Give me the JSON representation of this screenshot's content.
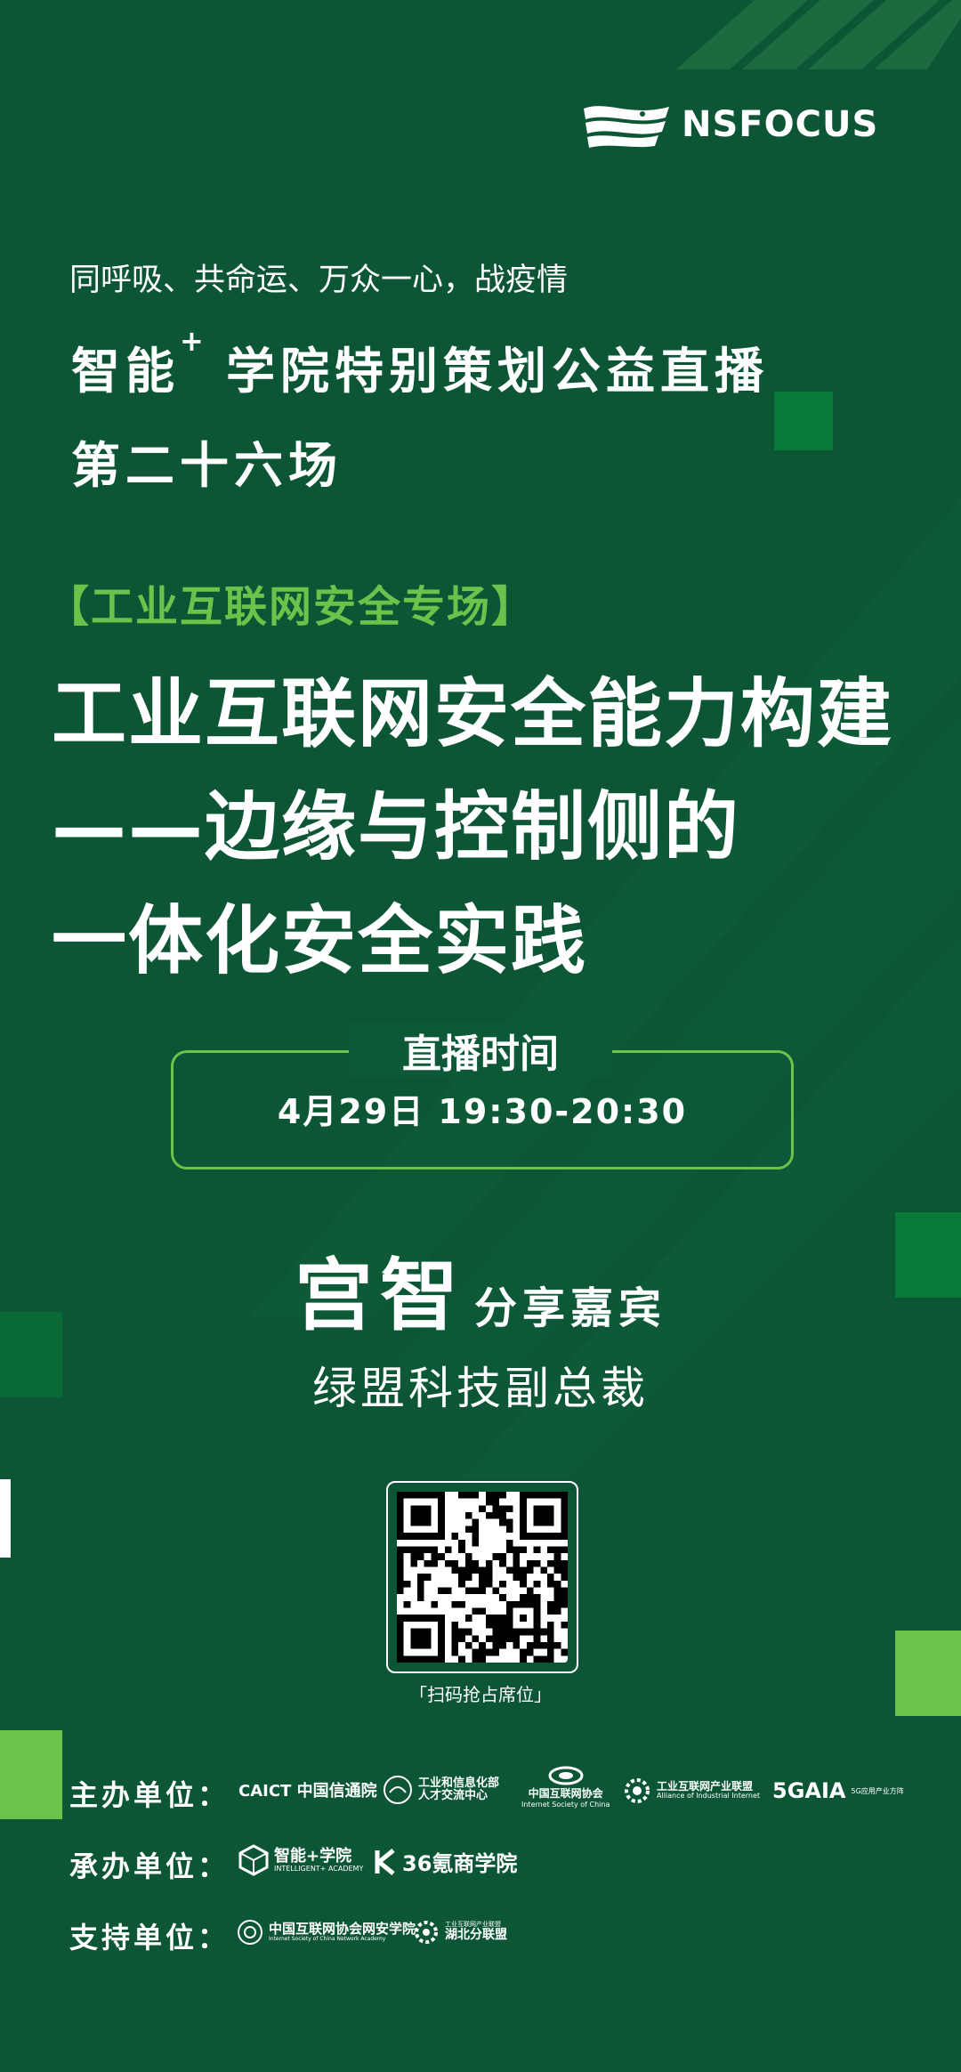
{
  "brand": {
    "logo_text": "NSFOCUS"
  },
  "header": {
    "slogan": "同呼吸、共命运、万众一心，战疫情",
    "headline_line1": "智能",
    "headline_sup": "+",
    "headline_line1_rest": "学院特别策划公益直播",
    "headline_line2": "第二十六场"
  },
  "topic": "【工业互联网安全专场】",
  "title": {
    "line1": "工业互联网安全能力构建",
    "line2": "——边缘与控制侧的",
    "line3": "一体化安全实践"
  },
  "schedule": {
    "label": "直播时间",
    "value": "4月29日 19:30-20:30"
  },
  "speaker": {
    "name": "宫智",
    "role": "分享嘉宾",
    "title": "绿盟科技副总裁"
  },
  "qr": {
    "caption": "「扫码抢占席位」"
  },
  "organizers": {
    "host_label": "主办单位：",
    "host": [
      {
        "main": "CAICT 中国信通院"
      },
      {
        "main": "工业和信息化部",
        "sub": "人才交流中心"
      },
      {
        "main": "中国互联网协会",
        "sub": "Internet Society of China"
      },
      {
        "main": "工业互联网产业联盟",
        "sub": "Alliance of Industrial Internet"
      },
      {
        "main": "5GAIA",
        "sub": "5G应用产业方阵"
      }
    ],
    "undertake_label": "承办单位：",
    "undertake": [
      {
        "main": "智能+学院",
        "sub": "INTELLIGENT+ ACADEMY"
      },
      {
        "main": "36氪商学院"
      }
    ],
    "support_label": "支持单位：",
    "support": [
      {
        "main": "中国互联网协会网安学院",
        "sub": "Internet Society of China Network Academy"
      },
      {
        "main": "湖北分联盟",
        "sub": "工业互联网产业联盟"
      }
    ]
  },
  "colors": {
    "background": "#0c5635",
    "accent_green": "#6cc24a",
    "dark_green_block": "#0a7a3a",
    "text": "#ffffff"
  }
}
